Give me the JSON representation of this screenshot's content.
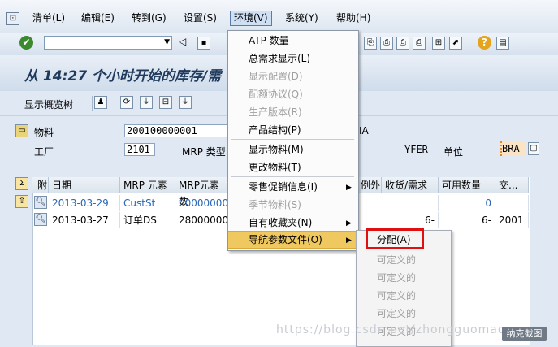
{
  "menubar": {
    "items": [
      "清单(L)",
      "编辑(E)",
      "转到(G)",
      "设置(S)",
      "环境(V)",
      "系统(Y)",
      "帮助(H)"
    ]
  },
  "title": "从 14:27 个小时开始的库存/需",
  "app_toolbar": {
    "show_tree": "显示概览树"
  },
  "header": {
    "material_label": "物料",
    "material_value": "200100000001",
    "material_desc_tail": "IA",
    "plant_label": "工厂",
    "plant_value": "2101",
    "mrp_type_label": "MRP 类型",
    "yfer": "YFER",
    "unit_label": "单位",
    "unit_value": "BRA"
  },
  "grid": {
    "columns": [
      "附",
      "日期",
      "MRP 元素",
      "MRP元素数",
      "例外",
      "收货/需求",
      "可用数量",
      "交..."
    ],
    "rows": [
      {
        "date": "2013-03-29",
        "element": "CustSt",
        "data": "00000000",
        "receipt": "",
        "available": "0",
        "extra": ""
      },
      {
        "date": "2013-03-27",
        "element": "订单DS",
        "data": "28000000",
        "receipt": "6-",
        "available": "6-",
        "extra": "2001"
      }
    ]
  },
  "env_menu": {
    "items": [
      {
        "label": "ATP 数量",
        "disabled": false
      },
      {
        "label": "总需求显示(L)",
        "disabled": false
      },
      {
        "label": "显示配置(D)",
        "disabled": true
      },
      {
        "label": "配额协议(Q)",
        "disabled": true
      },
      {
        "label": "生产版本(R)",
        "disabled": true
      },
      {
        "label": "产品结构(P)",
        "disabled": false
      },
      {
        "label": "显示物料(M)",
        "disabled": false
      },
      {
        "label": "更改物料(T)",
        "disabled": false
      },
      {
        "label": "零售促销信息(I)",
        "disabled": false
      },
      {
        "label": "季节物料(S)",
        "disabled": true
      },
      {
        "label": "自有收藏夹(N)",
        "disabled": false
      },
      {
        "label": "导航参数文件(O)",
        "disabled": false
      }
    ]
  },
  "submenu": {
    "items": [
      "分配(A)",
      "可定义的",
      "可定义的",
      "可定义的",
      "可定义的",
      "可定义的"
    ]
  },
  "watermark": "https://blog.csdn.net/zhongguomao",
  "snap_button": "纳克截图"
}
